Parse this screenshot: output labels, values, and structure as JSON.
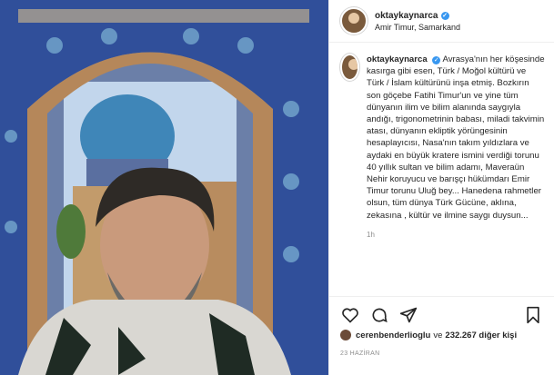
{
  "post": {
    "username": "oktaykaynarca",
    "location": "Amir Timur, Samarkand",
    "caption": "Avrasya'nın her köşesinde kasırga gibi esen, Türk / Moğol kültürü ve Türk / İslam kültürünü inşa etmiş. Bozkırın son göçebe Fatihi Timur'un ve yine tüm dünyanın ilim ve bilim alanında saygıyla andığı, trigonometrinin babası, miladi takvimin atası, dünyanın ekliptik yörüngesinin hesaplayıcısı, Nasa'nın takım yıldızlara ve aydaki en büyük kratere ismini verdiği torunu 40 yıllık sultan ve bilim adamı, Maveraün Nehir koruyucu ve barışçı hükümdarı Emir Timur torunu Uluğ bey... Hanedena rahmetler olsun, tüm dünya Türk Gücüne, aklına, zekasına , kültür ve ilmine saygı duysun...",
    "time_ago": "1h",
    "liked_by_user": "cerenbenderlioglu",
    "likes_connector": "ve",
    "likes_others": "232.267 diğer kişi",
    "date": "23 HAZİRAN"
  },
  "icons": {
    "verified": "verified-badge-icon",
    "like": "heart-icon",
    "comment": "comment-icon",
    "share": "share-icon",
    "save": "bookmark-icon"
  },
  "colors": {
    "verified": "#3897f0",
    "muted": "#8e8e8e",
    "text": "#262626"
  }
}
